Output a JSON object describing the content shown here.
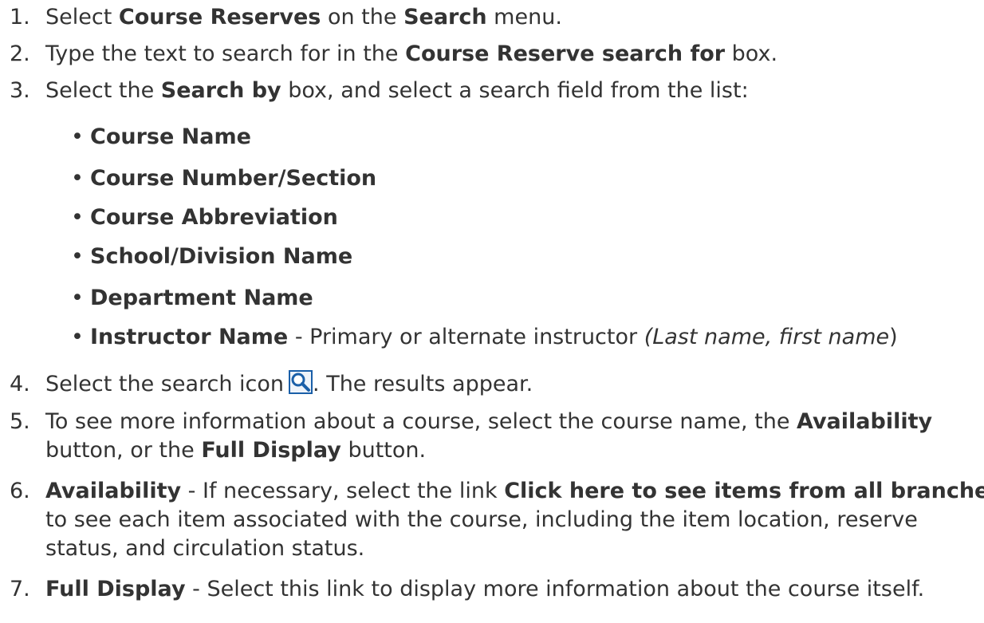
{
  "steps": [
    {
      "num": "1.",
      "a": "Select ",
      "b": "Course Reserves",
      "c": " on the ",
      "d": "Search",
      "e": " menu."
    },
    {
      "num": "2.",
      "a": "Type the text to search for in the ",
      "b": "Course Reserve search for",
      "c": " box."
    },
    {
      "num": "3.",
      "a": "Select the ",
      "b": "Search by",
      "c": " box, and select a search field from the list:"
    },
    {
      "num": "4.",
      "a": "Select the search icon",
      "c": ". The results appear."
    },
    {
      "num": "5.",
      "a": "To see more information about a course, select the course name, the ",
      "b": "Availability",
      "line2a": "button, or the ",
      "line2b": "Full Display",
      "line2c": " button."
    },
    {
      "num": "6.",
      "b": "Availability",
      "a": " - If necessary, select the link ",
      "c": "Click here to see items from all branches",
      "line2": "to see each item associated with the course, including the item location, reserve",
      "line3": "status, and circulation status."
    },
    {
      "num": "7.",
      "b": "Full Display",
      "a": " - Select this link to display more information about the course itself."
    }
  ],
  "bullets": [
    {
      "label": "Course Name"
    },
    {
      "label": "Course Number/Section"
    },
    {
      "label": "Course Abbreviation"
    },
    {
      "label": "School/Division Name"
    },
    {
      "label": "Department Name"
    },
    {
      "label": "Instructor Name",
      "rest": " - Primary or alternate instructor ",
      "italic": "(Last name, first name",
      "close": ")"
    }
  ],
  "bullet_glyph": "•",
  "icons": {
    "search": "search-icon"
  },
  "colors": {
    "text": "#333333",
    "icon_border": "#1a5fa8"
  }
}
